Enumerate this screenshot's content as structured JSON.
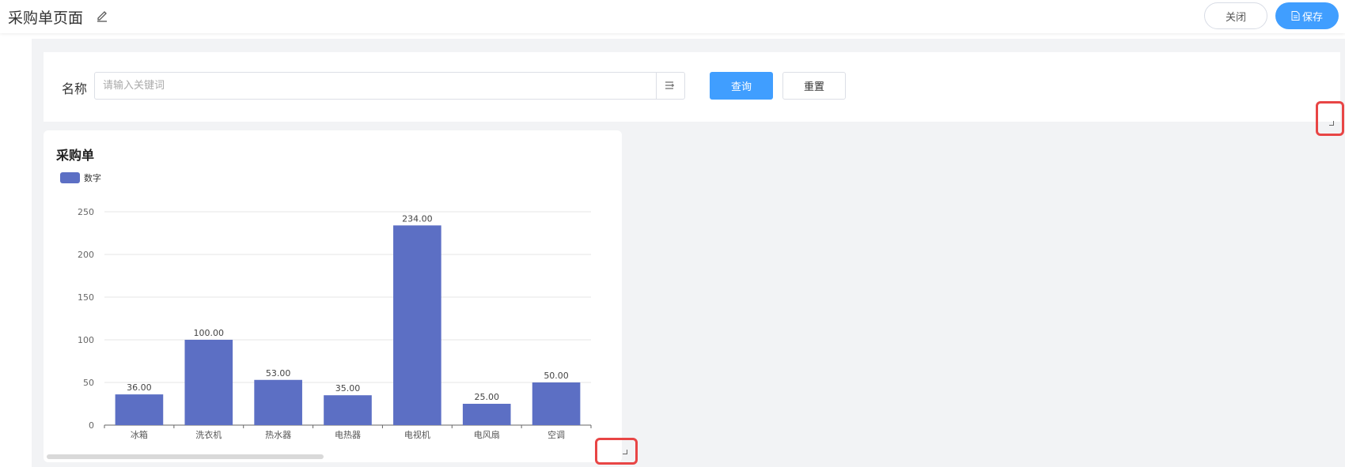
{
  "header": {
    "title": "采购单页面",
    "close_label": "关闭",
    "save_label": "保存"
  },
  "search": {
    "name_label": "名称",
    "placeholder": "请输入关键词",
    "query_label": "查询",
    "reset_label": "重置"
  },
  "colors": {
    "accent": "#409eff",
    "bar": "#5c6fc4",
    "highlight": "#e84545"
  },
  "chart": {
    "title": "采购单",
    "legend": "数字"
  },
  "chart_data": {
    "type": "bar",
    "title": "采购单",
    "categories": [
      "冰箱",
      "洗衣机",
      "热水器",
      "电热器",
      "电视机",
      "电风扇",
      "空调"
    ],
    "series": [
      {
        "name": "数字",
        "values": [
          36,
          100,
          53,
          35,
          234,
          25,
          50
        ]
      }
    ],
    "data_labels": [
      "36.00",
      "100.00",
      "53.00",
      "35.00",
      "234.00",
      "25.00",
      "50.00"
    ],
    "y_ticks": [
      0,
      50,
      100,
      150,
      200,
      250
    ],
    "ylim": [
      0,
      250
    ],
    "grid": true,
    "legend_position": "top-left"
  }
}
